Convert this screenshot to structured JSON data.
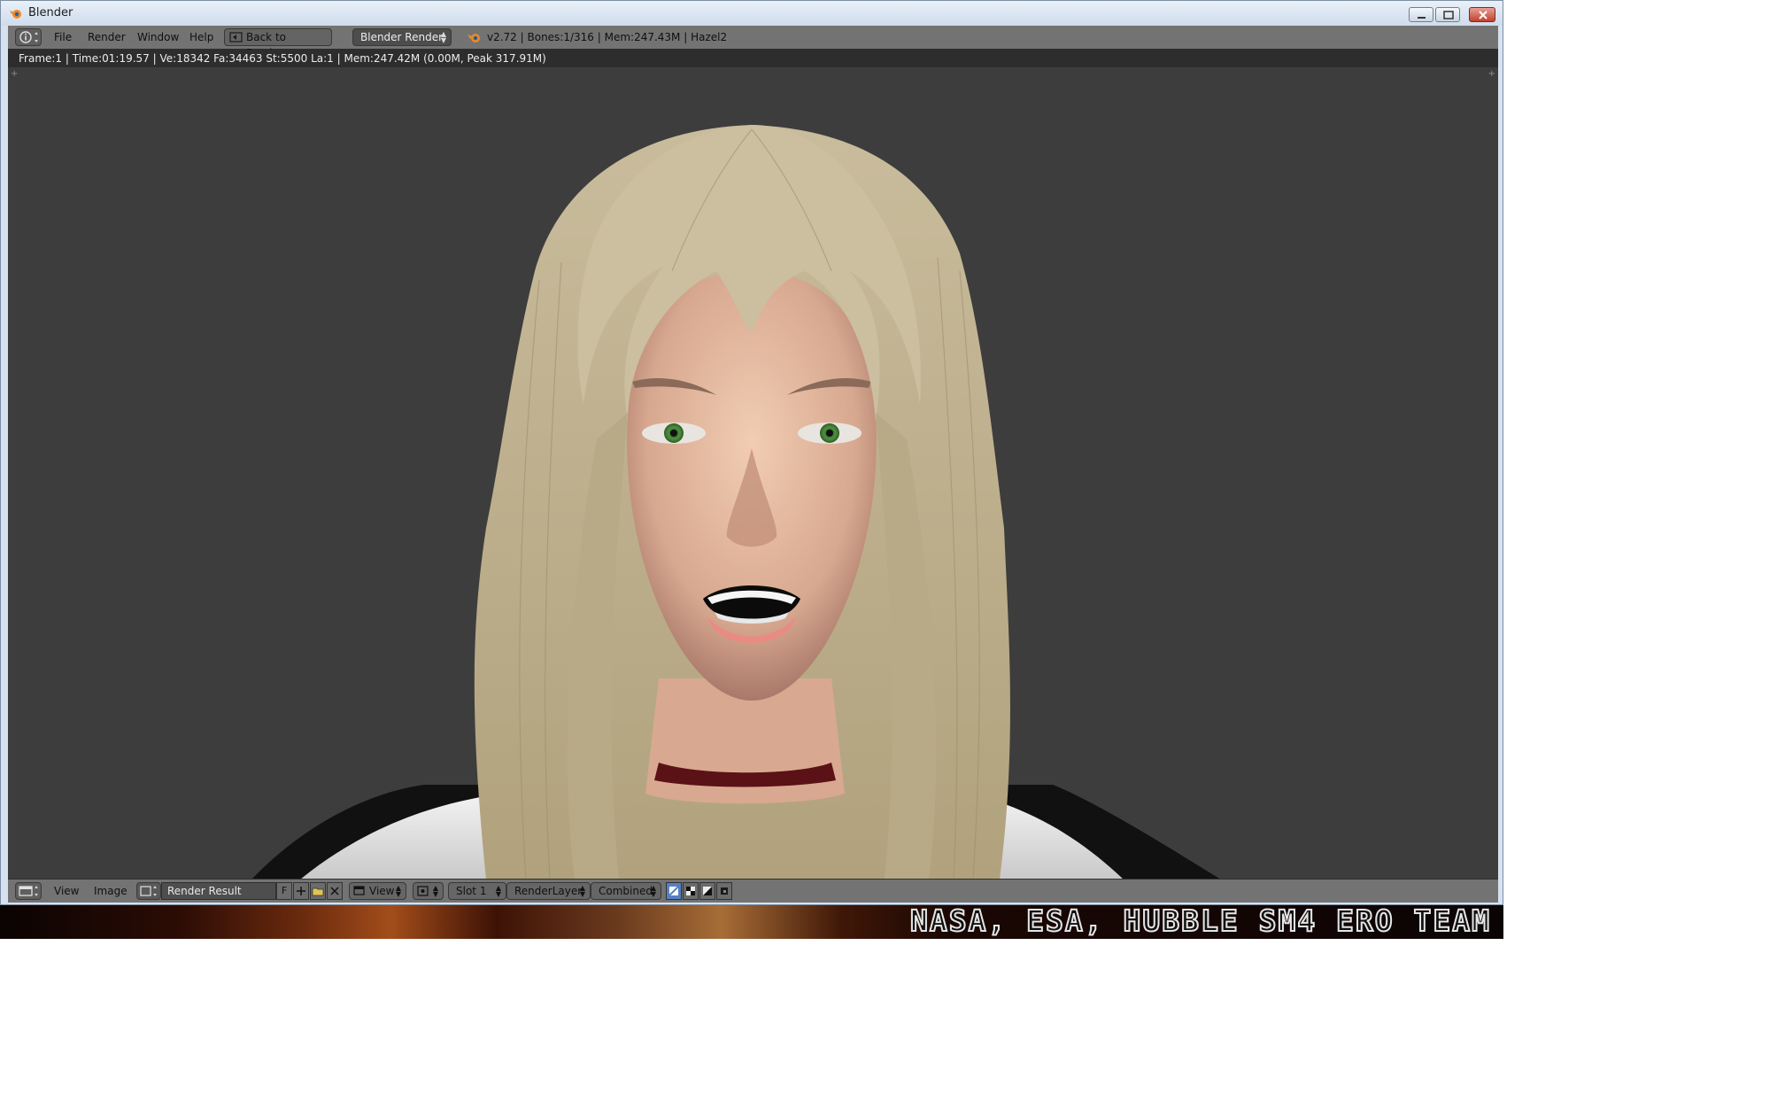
{
  "window": {
    "title": "Blender",
    "controls": [
      "minimize-icon",
      "maximize-icon",
      "close-icon"
    ]
  },
  "menubar": {
    "editor_icon": "info-icon",
    "menus": [
      "File",
      "Render",
      "Window",
      "Help"
    ],
    "back_button": "Back to Previous",
    "render_engine": "Blender Render",
    "info_text": "v2.72 | Bones:1/316  | Mem:247.43M | Hazel2"
  },
  "status": {
    "text": "Frame:1 | Time:01:19.57 | Ve:18342 Fa:34463 St:5500 La:1 | Mem:247.42M (0.00M, Peak 317.91M)"
  },
  "viewport": {
    "content": "rendered 3D character portrait",
    "corner_left": "+",
    "corner_right": "+"
  },
  "image_editor_header": {
    "editor_icon": "image-editor-icon",
    "menus": [
      "View",
      "Image"
    ],
    "image_name": "Render Result",
    "fake_user": "F",
    "view_mode": "View",
    "slot": "Slot 1",
    "render_layer": "RenderLayer",
    "pass": "Combined",
    "active_display_button": 0
  },
  "banner": {
    "text": "NASA, ESA, HUBBLE SM4 ERO TEAM"
  },
  "colors": {
    "ui_gray": "#737373",
    "viewport_bg": "#3d3d3d",
    "status_bg": "#2d2d2d",
    "accent": "#5680c2"
  }
}
